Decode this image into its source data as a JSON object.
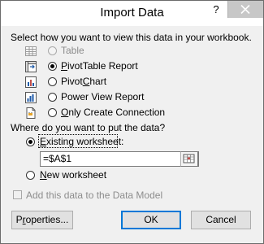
{
  "dialog": {
    "title": "Import Data",
    "help_label": "?",
    "prompt_view": "Select how you want to view this data in your workbook.",
    "view_options": [
      {
        "accel": "",
        "rest": "Table",
        "icon": "table-icon",
        "checked": false,
        "enabled": false
      },
      {
        "accel": "P",
        "rest": "ivotTable Report",
        "icon": "pivottable-icon",
        "checked": true,
        "enabled": true
      },
      {
        "accel": "",
        "pre": "Pivot",
        "mid": "C",
        "rest": "hart",
        "icon": "pivotchart-icon",
        "checked": false,
        "enabled": true
      },
      {
        "accel": "",
        "rest": "Power View Report",
        "icon": "power-view-icon",
        "checked": false,
        "enabled": true
      },
      {
        "accel": "O",
        "rest": "nly Create Connection",
        "icon": "connection-icon",
        "checked": false,
        "enabled": true
      }
    ],
    "prompt_where": "Where do you want to put the data?",
    "existing_worksheet": {
      "accel": "E",
      "rest": "xisting worksheet:",
      "checked": true
    },
    "range_value": "=$A$1",
    "new_worksheet": {
      "accel": "N",
      "rest": "ew worksheet",
      "checked": false
    },
    "data_model": {
      "label": "Add this data to the Data Model",
      "enabled": false,
      "checked": false
    },
    "buttons": {
      "properties": {
        "accel": "r",
        "pre": "P",
        "rest": "operties..."
      },
      "ok": "OK",
      "cancel": "Cancel"
    },
    "colors": {
      "accent": "#0078d7",
      "background": "#f0f0f0",
      "disabled_text": "#8d8d8d"
    }
  }
}
